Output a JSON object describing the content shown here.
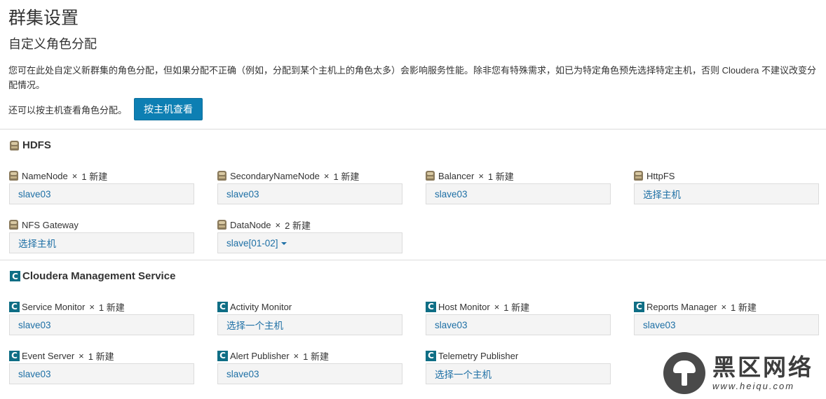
{
  "page": {
    "title": "群集设置",
    "subtitle": "自定义角色分配",
    "description": "您可在此处自定义新群集的角色分配，但如果分配不正确（例如，分配到某个主机上的角色太多）会影响服务性能。除非您有特殊需求，如已为特定角色预先选择特定主机，否则 Cloudera 不建议改变分配情况。",
    "byhost_label": "还可以按主机查看角色分配。",
    "byhost_button": "按主机查看"
  },
  "hdfs": {
    "title": "HDFS",
    "roles": [
      {
        "name": "NameNode",
        "times": "×",
        "count": "1 新建",
        "host": "slave03"
      },
      {
        "name": "SecondaryNameNode",
        "times": "×",
        "count": "1 新建",
        "host": "slave03"
      },
      {
        "name": "Balancer",
        "times": "×",
        "count": "1 新建",
        "host": "slave03"
      },
      {
        "name": "HttpFS",
        "times": "",
        "count": "",
        "host": "选择主机"
      },
      {
        "name": "NFS Gateway",
        "times": "",
        "count": "",
        "host": "选择主机"
      },
      {
        "name": "DataNode",
        "times": "×",
        "count": "2 新建",
        "host": "slave[01-02]"
      }
    ]
  },
  "cms": {
    "title": "Cloudera Management Service",
    "icon_letter": "C",
    "roles": [
      {
        "name": "Service Monitor",
        "times": "×",
        "count": "1 新建",
        "host": "slave03"
      },
      {
        "name": "Activity Monitor",
        "times": "",
        "count": "",
        "host": "选择一个主机"
      },
      {
        "name": "Host Monitor",
        "times": "×",
        "count": "1 新建",
        "host": "slave03"
      },
      {
        "name": "Reports Manager",
        "times": "×",
        "count": "1 新建",
        "host": "slave03"
      },
      {
        "name": "Event Server",
        "times": "×",
        "count": "1 新建",
        "host": "slave03"
      },
      {
        "name": "Alert Publisher",
        "times": "×",
        "count": "1 新建",
        "host": "slave03"
      },
      {
        "name": "Telemetry Publisher",
        "times": "",
        "count": "",
        "host": "选择一个主机"
      }
    ]
  },
  "watermark": {
    "cn": "黑区网络",
    "en": "www.heiqu.com"
  },
  "colors": {
    "button_bg": "#0d7fb3",
    "link": "#1d6fa5",
    "cms_icon": "#0f6e85"
  },
  "icons": {
    "hdfs": "hdfs-icon",
    "cms": "cloudera-c-icon",
    "dropdown": "caret-down-icon"
  }
}
